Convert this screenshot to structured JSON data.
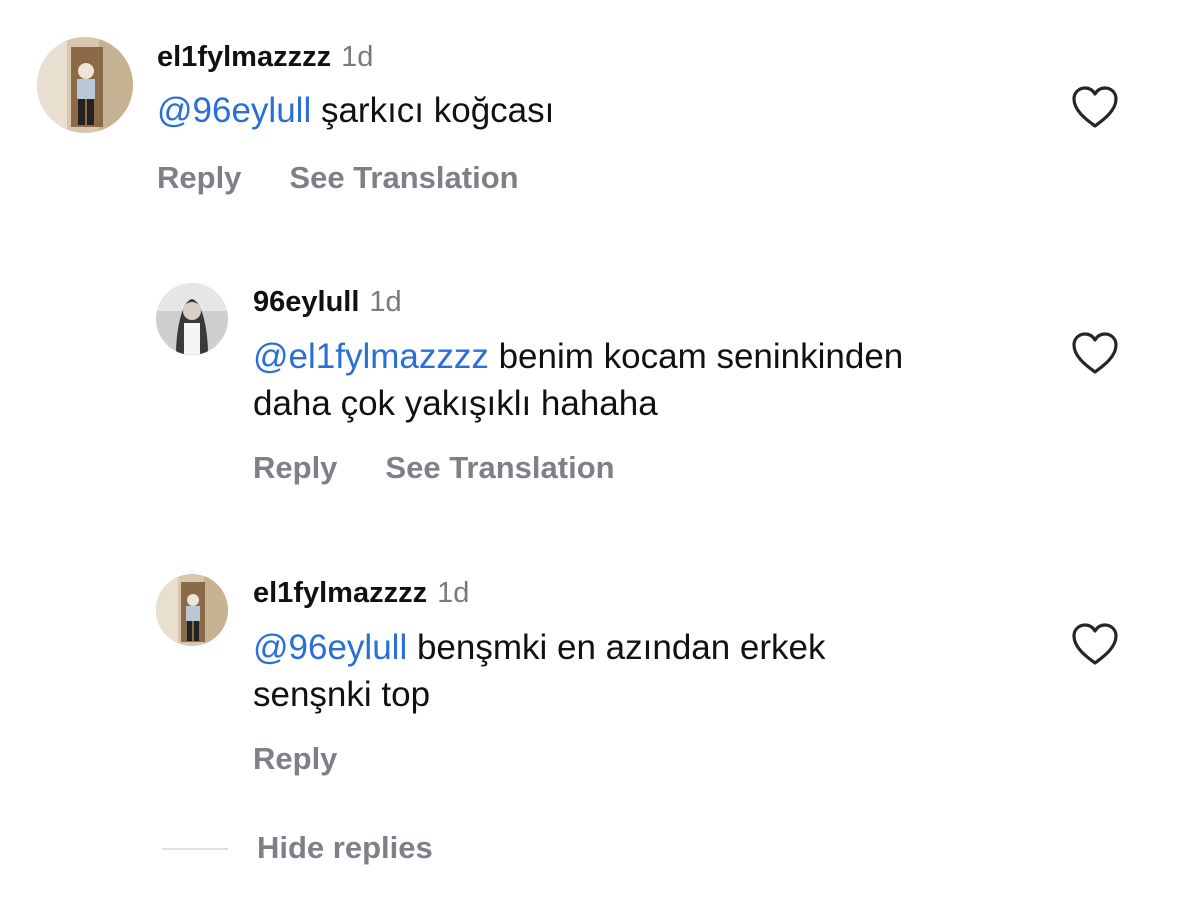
{
  "comments": [
    {
      "username": "el1fylmazzzz",
      "time": "1d",
      "mention": "@96eylull",
      "text": "şarkıcı koğcası",
      "reply_label": "Reply",
      "translate_label": "See Translation"
    },
    {
      "username": "96eylull",
      "time": "1d",
      "mention": "@el1fylmazzzz",
      "text_line1": "benim kocam seninkinden",
      "text_line2": "daha çok yakışıklı hahaha",
      "reply_label": "Reply",
      "translate_label": "See Translation"
    },
    {
      "username": "el1fylmazzzz",
      "time": "1d",
      "mention": "@96eylull",
      "text_line1": "benşmki en azından erkek",
      "text_line2": "senşnki top",
      "reply_label": "Reply"
    }
  ],
  "hide_replies_label": "Hide replies",
  "colors": {
    "mention": "#2a6fd6",
    "secondary_text": "#7d8187",
    "heart_outline": "#262626"
  },
  "icons": [
    "heart-icon"
  ]
}
